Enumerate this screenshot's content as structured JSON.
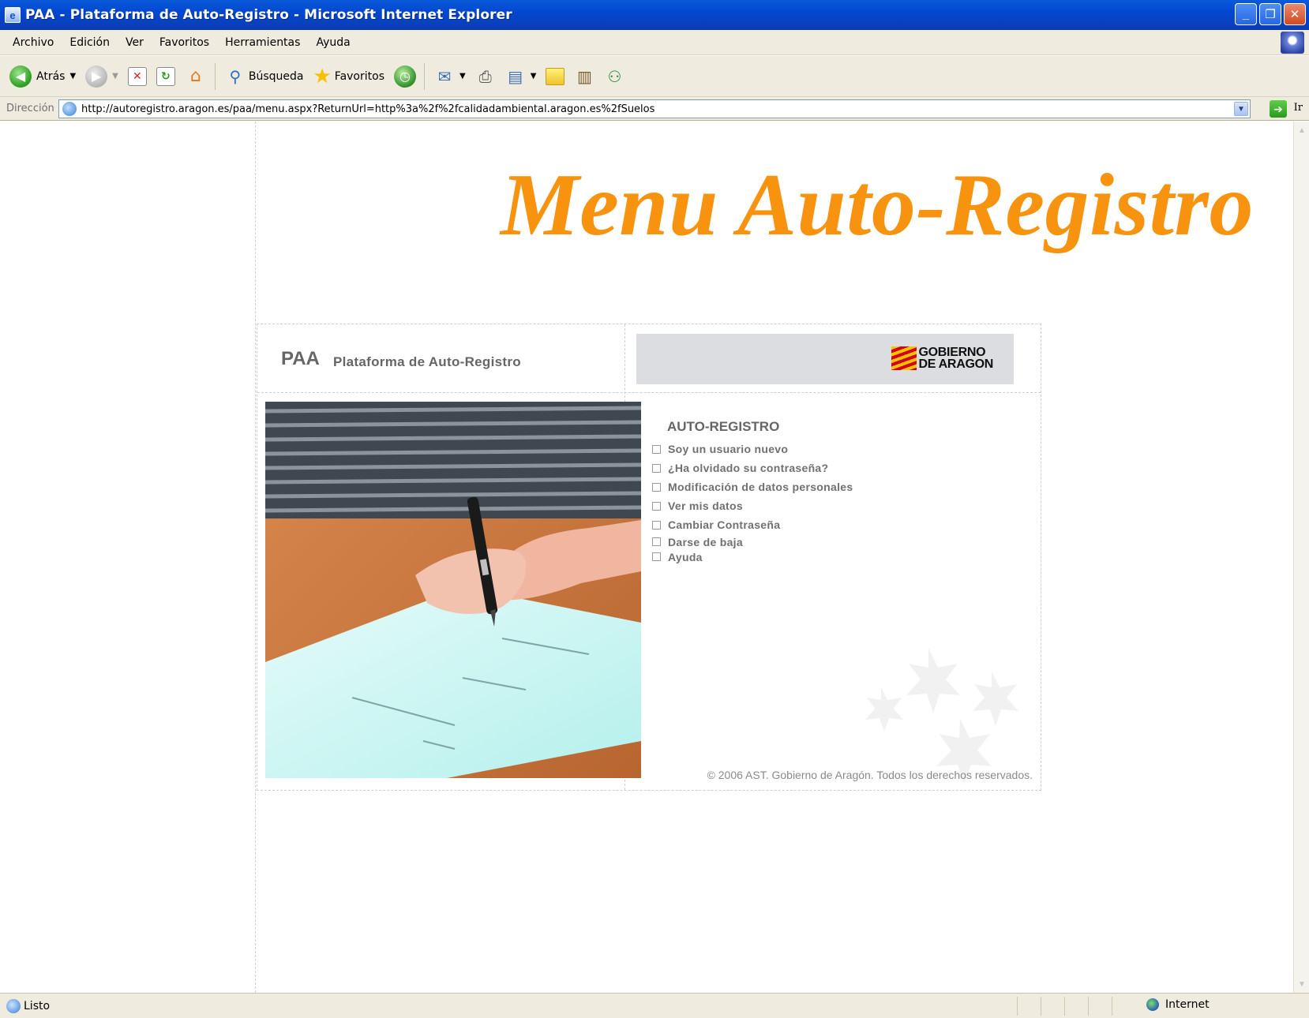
{
  "window": {
    "title": "PAA - Plataforma de Auto-Registro - Microsoft Internet Explorer",
    "controls": [
      "minimize",
      "maximize",
      "close"
    ]
  },
  "menubar": {
    "items": [
      "Archivo",
      "Edición",
      "Ver",
      "Favoritos",
      "Herramientas",
      "Ayuda"
    ]
  },
  "toolbar": {
    "back_label": "Atrás",
    "search_label": "Búsqueda",
    "favorites_label": "Favoritos"
  },
  "address": {
    "label": "Dirección",
    "url": "http://autoregistro.aragon.es/paa/menu.aspx?ReturnUrl=http%3a%2f%2fcalidadambiental.aragon.es%2fSuelos",
    "go_label": "Ir"
  },
  "page": {
    "heading": "Menu Auto-Registro",
    "paa_abbr": "PAA",
    "paa_name": "Plataforma de Auto-Registro",
    "gov_logo_line1": "GOBIERNO",
    "gov_logo_line2": "DE ARAGON",
    "menu_title": "AUTO-REGISTRO",
    "menu_items": [
      "Soy un usuario nuevo",
      "¿Ha olvidado su contraseña?",
      "Modificación de datos personales",
      "Ver mis datos",
      "Cambiar Contraseña",
      "Darse de baja",
      "Ayuda"
    ],
    "copyright": "© 2006 AST. Gobierno de Aragón. Todos los derechos reservados."
  },
  "statusbar": {
    "status": "Listo",
    "zone": "Internet"
  },
  "colors": {
    "heading": "#f7930e",
    "titlebar": "#0347d0",
    "chrome": "#efebde"
  }
}
